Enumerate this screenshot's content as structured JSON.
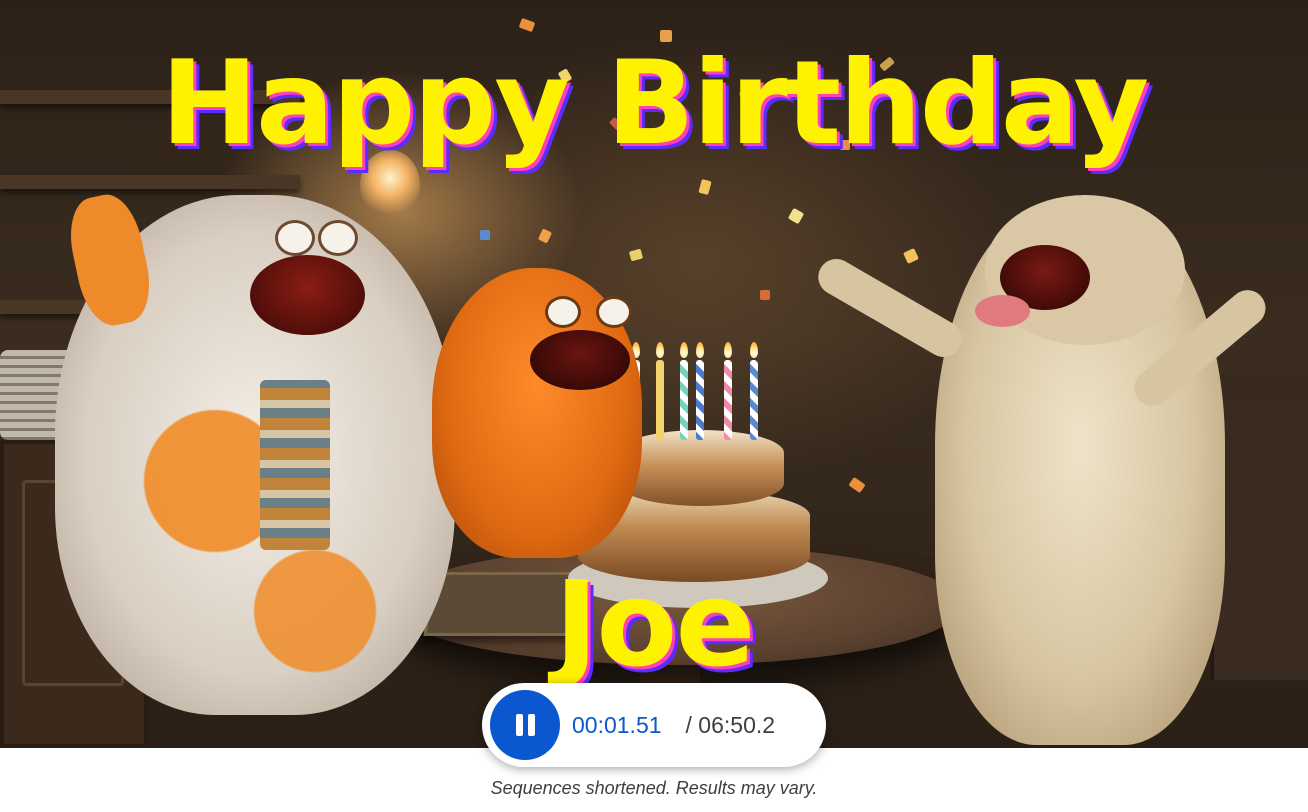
{
  "video": {
    "title_line1": "Happy Birthday",
    "title_line2": "Joe",
    "scene_icon": "birthday-party-scene"
  },
  "player": {
    "pause_icon": "pause-icon",
    "current_time": "00:01.51",
    "total_time": "/ 06:50.2"
  },
  "footer": {
    "disclaimer": "Sequences shortened. Results may vary."
  },
  "colors": {
    "accent_blue": "#0b57d0",
    "title_yellow": "#fff200",
    "title_shadow_pink": "#ff3fb6",
    "title_shadow_purple": "#5a2cff"
  }
}
